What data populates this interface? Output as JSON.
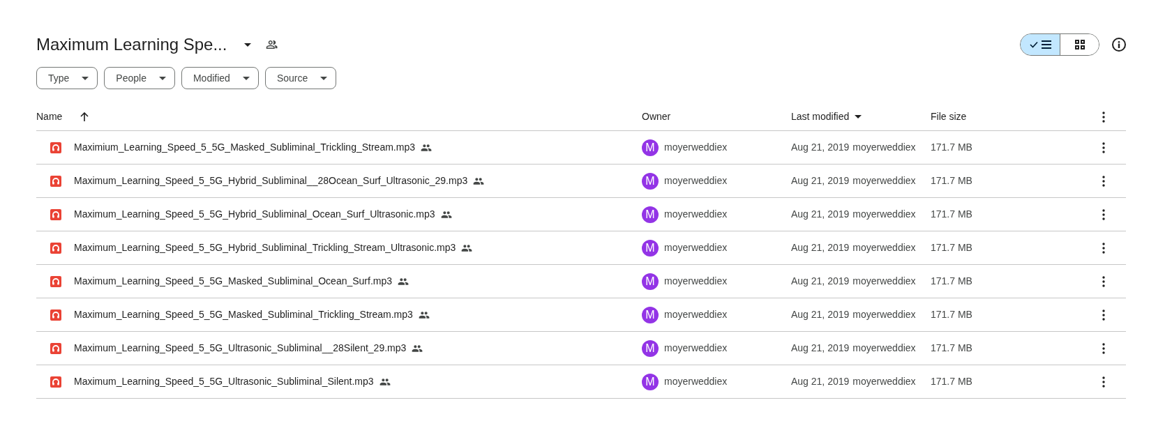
{
  "folder": {
    "title": "Maximum Learning Spe..."
  },
  "view_toggle": [
    {
      "kind": "list",
      "selected": true
    },
    {
      "kind": "grid",
      "selected": false
    }
  ],
  "filters": [
    "Type",
    "People",
    "Modified",
    "Source"
  ],
  "table": {
    "columns": [
      {
        "label": "Name",
        "sorted": true,
        "descending": false
      },
      {
        "label": "Owner",
        "sorted": false
      },
      {
        "label": "Last modified",
        "sorted": true,
        "descending": true
      },
      {
        "label": "File size",
        "sorted": false
      }
    ],
    "rows": [
      {
        "name": "Maximium_Learning_Speed_5_5G_Masked_Subliminal_Trickling_Stream.mp3",
        "shared": true,
        "owner_initial": "M",
        "owner": "moyerweddiex",
        "modified": "Aug 21, 2019",
        "modified_by": "moyerweddiex",
        "size": "171.7 MB"
      },
      {
        "name": "Maximum_Learning_Speed_5_5G_Hybrid_Subliminal__28Ocean_Surf_Ultrasonic_29.mp3",
        "shared": true,
        "owner_initial": "M",
        "owner": "moyerweddiex",
        "modified": "Aug 21, 2019",
        "modified_by": "moyerweddiex",
        "size": "171.7 MB"
      },
      {
        "name": "Maximum_Learning_Speed_5_5G_Hybrid_Subliminal_Ocean_Surf_Ultrasonic.mp3",
        "shared": true,
        "owner_initial": "M",
        "owner": "moyerweddiex",
        "modified": "Aug 21, 2019",
        "modified_by": "moyerweddiex",
        "size": "171.7 MB"
      },
      {
        "name": "Maximum_Learning_Speed_5_5G_Hybrid_Subliminal_Trickling_Stream_Ultrasonic.mp3",
        "shared": true,
        "owner_initial": "M",
        "owner": "moyerweddiex",
        "modified": "Aug 21, 2019",
        "modified_by": "moyerweddiex",
        "size": "171.7 MB"
      },
      {
        "name": "Maximum_Learning_Speed_5_5G_Masked_Subliminal_Ocean_Surf.mp3",
        "shared": true,
        "owner_initial": "M",
        "owner": "moyerweddiex",
        "modified": "Aug 21, 2019",
        "modified_by": "moyerweddiex",
        "size": "171.7 MB"
      },
      {
        "name": "Maximum_Learning_Speed_5_5G_Masked_Subliminal_Trickling_Stream.mp3",
        "shared": true,
        "owner_initial": "M",
        "owner": "moyerweddiex",
        "modified": "Aug 21, 2019",
        "modified_by": "moyerweddiex",
        "size": "171.7 MB"
      },
      {
        "name": "Maximum_Learning_Speed_5_5G_Ultrasonic_Subliminal__28Silent_29.mp3",
        "shared": true,
        "owner_initial": "M",
        "owner": "moyerweddiex",
        "modified": "Aug 21, 2019",
        "modified_by": "moyerweddiex",
        "size": "171.7 MB"
      },
      {
        "name": "Maximum_Learning_Speed_5_5G_Ultrasonic_Subliminal_Silent.mp3",
        "shared": true,
        "owner_initial": "M",
        "owner": "moyerweddiex",
        "modified": "Aug 21, 2019",
        "modified_by": "moyerweddiex",
        "size": "171.7 MB"
      }
    ]
  }
}
